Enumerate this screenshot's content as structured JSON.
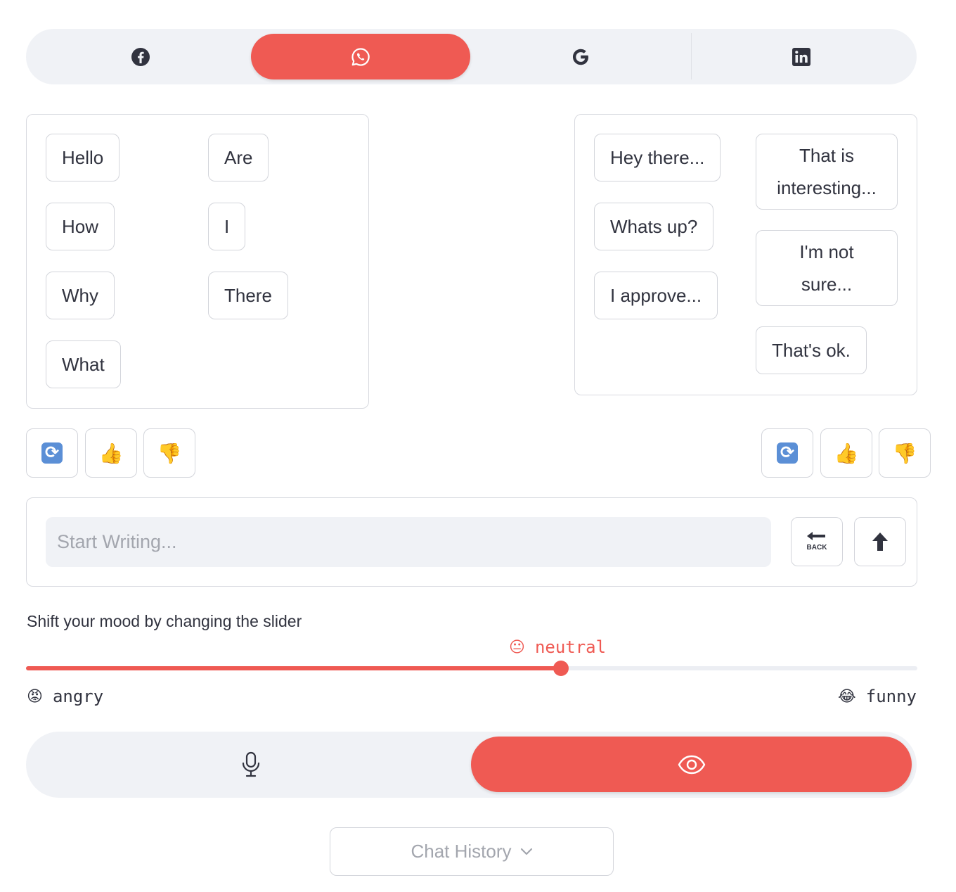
{
  "platforms": [
    {
      "icon": "facebook-icon",
      "active": false
    },
    {
      "icon": "whatsapp-icon",
      "active": true
    },
    {
      "icon": "google-icon",
      "active": false
    },
    {
      "icon": "linkedin-icon",
      "active": false
    }
  ],
  "left_panel": {
    "words": [
      "Hello",
      "How",
      "Why",
      "What",
      "Are",
      "I",
      "There"
    ]
  },
  "right_panel": {
    "phrases": [
      "Hey there...",
      "Whats up?",
      "I approve...",
      "That is interesting...",
      "I'm not sure...",
      "That's ok."
    ]
  },
  "reactions": {
    "refresh_icon": "refresh-icon",
    "thumbs_up": "👍",
    "thumbs_down": "👎"
  },
  "writer": {
    "placeholder": "Start Writing...",
    "value": "",
    "back_label": "BACK"
  },
  "mood": {
    "label": "Shift your mood by changing the slider",
    "current": "neutral",
    "current_emoji": "😐",
    "min_label": "angry",
    "min_emoji": "😡",
    "max_label": "funny",
    "max_emoji": "😂",
    "value_fraction": 0.6
  },
  "modes": [
    {
      "icon": "microphone-icon",
      "active": false
    },
    {
      "icon": "eye-icon",
      "active": true
    }
  ],
  "history": {
    "label": "Chat History"
  },
  "colors": {
    "accent": "#ef5a53",
    "control_bg": "#f0f2f6",
    "text": "#31333f",
    "placeholder": "#a3a6ae"
  }
}
